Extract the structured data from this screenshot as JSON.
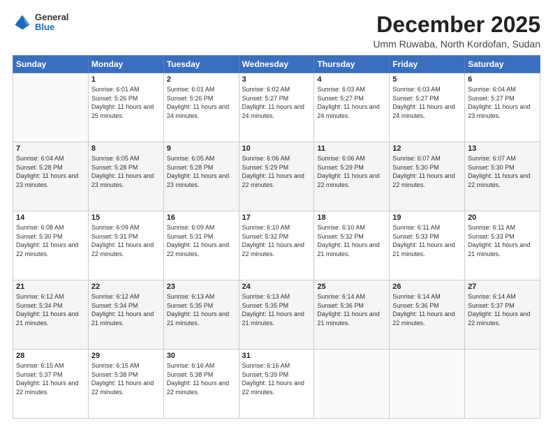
{
  "header": {
    "logo": {
      "general": "General",
      "blue": "Blue"
    },
    "title": "December 2025",
    "subtitle": "Umm Ruwaba, North Kordofan, Sudan"
  },
  "calendar": {
    "days_of_week": [
      "Sunday",
      "Monday",
      "Tuesday",
      "Wednesday",
      "Thursday",
      "Friday",
      "Saturday"
    ],
    "weeks": [
      [
        {
          "day": "",
          "sunrise": "",
          "sunset": "",
          "daylight": ""
        },
        {
          "day": "1",
          "sunrise": "Sunrise: 6:01 AM",
          "sunset": "Sunset: 5:26 PM",
          "daylight": "Daylight: 11 hours and 25 minutes."
        },
        {
          "day": "2",
          "sunrise": "Sunrise: 6:01 AM",
          "sunset": "Sunset: 5:26 PM",
          "daylight": "Daylight: 11 hours and 24 minutes."
        },
        {
          "day": "3",
          "sunrise": "Sunrise: 6:02 AM",
          "sunset": "Sunset: 5:27 PM",
          "daylight": "Daylight: 11 hours and 24 minutes."
        },
        {
          "day": "4",
          "sunrise": "Sunrise: 6:03 AM",
          "sunset": "Sunset: 5:27 PM",
          "daylight": "Daylight: 11 hours and 24 minutes."
        },
        {
          "day": "5",
          "sunrise": "Sunrise: 6:03 AM",
          "sunset": "Sunset: 5:27 PM",
          "daylight": "Daylight: 11 hours and 24 minutes."
        },
        {
          "day": "6",
          "sunrise": "Sunrise: 6:04 AM",
          "sunset": "Sunset: 5:27 PM",
          "daylight": "Daylight: 11 hours and 23 minutes."
        }
      ],
      [
        {
          "day": "7",
          "sunrise": "Sunrise: 6:04 AM",
          "sunset": "Sunset: 5:28 PM",
          "daylight": "Daylight: 11 hours and 23 minutes."
        },
        {
          "day": "8",
          "sunrise": "Sunrise: 6:05 AM",
          "sunset": "Sunset: 5:28 PM",
          "daylight": "Daylight: 11 hours and 23 minutes."
        },
        {
          "day": "9",
          "sunrise": "Sunrise: 6:05 AM",
          "sunset": "Sunset: 5:28 PM",
          "daylight": "Daylight: 11 hours and 23 minutes."
        },
        {
          "day": "10",
          "sunrise": "Sunrise: 6:06 AM",
          "sunset": "Sunset: 5:29 PM",
          "daylight": "Daylight: 11 hours and 22 minutes."
        },
        {
          "day": "11",
          "sunrise": "Sunrise: 6:06 AM",
          "sunset": "Sunset: 5:29 PM",
          "daylight": "Daylight: 11 hours and 22 minutes."
        },
        {
          "day": "12",
          "sunrise": "Sunrise: 6:07 AM",
          "sunset": "Sunset: 5:30 PM",
          "daylight": "Daylight: 11 hours and 22 minutes."
        },
        {
          "day": "13",
          "sunrise": "Sunrise: 6:07 AM",
          "sunset": "Sunset: 5:30 PM",
          "daylight": "Daylight: 11 hours and 22 minutes."
        }
      ],
      [
        {
          "day": "14",
          "sunrise": "Sunrise: 6:08 AM",
          "sunset": "Sunset: 5:30 PM",
          "daylight": "Daylight: 11 hours and 22 minutes."
        },
        {
          "day": "15",
          "sunrise": "Sunrise: 6:09 AM",
          "sunset": "Sunset: 5:31 PM",
          "daylight": "Daylight: 11 hours and 22 minutes."
        },
        {
          "day": "16",
          "sunrise": "Sunrise: 6:09 AM",
          "sunset": "Sunset: 5:31 PM",
          "daylight": "Daylight: 11 hours and 22 minutes."
        },
        {
          "day": "17",
          "sunrise": "Sunrise: 6:10 AM",
          "sunset": "Sunset: 5:32 PM",
          "daylight": "Daylight: 11 hours and 22 minutes."
        },
        {
          "day": "18",
          "sunrise": "Sunrise: 6:10 AM",
          "sunset": "Sunset: 5:32 PM",
          "daylight": "Daylight: 11 hours and 21 minutes."
        },
        {
          "day": "19",
          "sunrise": "Sunrise: 6:11 AM",
          "sunset": "Sunset: 5:33 PM",
          "daylight": "Daylight: 11 hours and 21 minutes."
        },
        {
          "day": "20",
          "sunrise": "Sunrise: 6:11 AM",
          "sunset": "Sunset: 5:33 PM",
          "daylight": "Daylight: 11 hours and 21 minutes."
        }
      ],
      [
        {
          "day": "21",
          "sunrise": "Sunrise: 6:12 AM",
          "sunset": "Sunset: 5:34 PM",
          "daylight": "Daylight: 11 hours and 21 minutes."
        },
        {
          "day": "22",
          "sunrise": "Sunrise: 6:12 AM",
          "sunset": "Sunset: 5:34 PM",
          "daylight": "Daylight: 11 hours and 21 minutes."
        },
        {
          "day": "23",
          "sunrise": "Sunrise: 6:13 AM",
          "sunset": "Sunset: 5:35 PM",
          "daylight": "Daylight: 11 hours and 21 minutes."
        },
        {
          "day": "24",
          "sunrise": "Sunrise: 6:13 AM",
          "sunset": "Sunset: 5:35 PM",
          "daylight": "Daylight: 11 hours and 21 minutes."
        },
        {
          "day": "25",
          "sunrise": "Sunrise: 6:14 AM",
          "sunset": "Sunset: 5:36 PM",
          "daylight": "Daylight: 11 hours and 21 minutes."
        },
        {
          "day": "26",
          "sunrise": "Sunrise: 6:14 AM",
          "sunset": "Sunset: 5:36 PM",
          "daylight": "Daylight: 11 hours and 22 minutes."
        },
        {
          "day": "27",
          "sunrise": "Sunrise: 6:14 AM",
          "sunset": "Sunset: 5:37 PM",
          "daylight": "Daylight: 11 hours and 22 minutes."
        }
      ],
      [
        {
          "day": "28",
          "sunrise": "Sunrise: 6:15 AM",
          "sunset": "Sunset: 5:37 PM",
          "daylight": "Daylight: 11 hours and 22 minutes."
        },
        {
          "day": "29",
          "sunrise": "Sunrise: 6:15 AM",
          "sunset": "Sunset: 5:38 PM",
          "daylight": "Daylight: 11 hours and 22 minutes."
        },
        {
          "day": "30",
          "sunrise": "Sunrise: 6:16 AM",
          "sunset": "Sunset: 5:38 PM",
          "daylight": "Daylight: 11 hours and 22 minutes."
        },
        {
          "day": "31",
          "sunrise": "Sunrise: 6:16 AM",
          "sunset": "Sunset: 5:39 PM",
          "daylight": "Daylight: 11 hours and 22 minutes."
        },
        {
          "day": "",
          "sunrise": "",
          "sunset": "",
          "daylight": ""
        },
        {
          "day": "",
          "sunrise": "",
          "sunset": "",
          "daylight": ""
        },
        {
          "day": "",
          "sunrise": "",
          "sunset": "",
          "daylight": ""
        }
      ]
    ]
  }
}
